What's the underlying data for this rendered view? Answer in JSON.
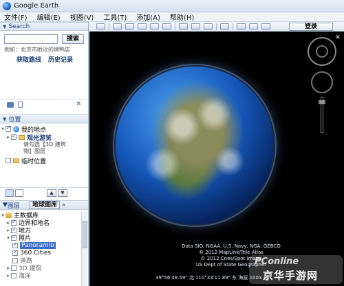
{
  "titlebar": {
    "title": "Google Earth"
  },
  "menu": {
    "items": [
      "文件(F)",
      "编辑(E)",
      "视图(V)",
      "工具(T)",
      "添加(A)",
      "帮助(H)"
    ]
  },
  "toolbar": {
    "signin_label": "登录"
  },
  "search": {
    "header": "Search",
    "input_value": "",
    "button_label": "搜索",
    "example": "例如：北京市附近的烤鸭店",
    "link_directions": "获取路线",
    "link_history": "历史记录"
  },
  "places": {
    "header": "位置",
    "items": [
      {
        "label": "我的地点"
      },
      {
        "label": "观光游览"
      },
      {
        "label": "临时位置"
      }
    ],
    "subtext_1": "请勾选【3D 建筑",
    "subtext_2": "物】图层"
  },
  "layers": {
    "header": "图层",
    "gallery_label": "地球图库",
    "items": [
      {
        "label": "主数据库"
      },
      {
        "label": "边界和地名"
      },
      {
        "label": "地方"
      },
      {
        "label": "照片"
      },
      {
        "label": "Panoramio"
      },
      {
        "label": "360 Cities"
      },
      {
        "label": "道路"
      },
      {
        "label": "3D 建筑"
      },
      {
        "label": "海洋"
      }
    ]
  },
  "map": {
    "attribution_1": "Data SIO, NOAA, U.S. Navy, NGA, GEBCO",
    "attribution_2": "© 2012 MapLink/Tele Atlas",
    "attribution_3": "© 2012 Cnes/Spot Image",
    "attribution_4": "US Dept of State Geographer",
    "status": "39°56'48.59\" 北  110°33'11.89\" 东  海拔 1003 米",
    "watermark_top": "PConline",
    "watermark_bottom": "京华手游网"
  }
}
